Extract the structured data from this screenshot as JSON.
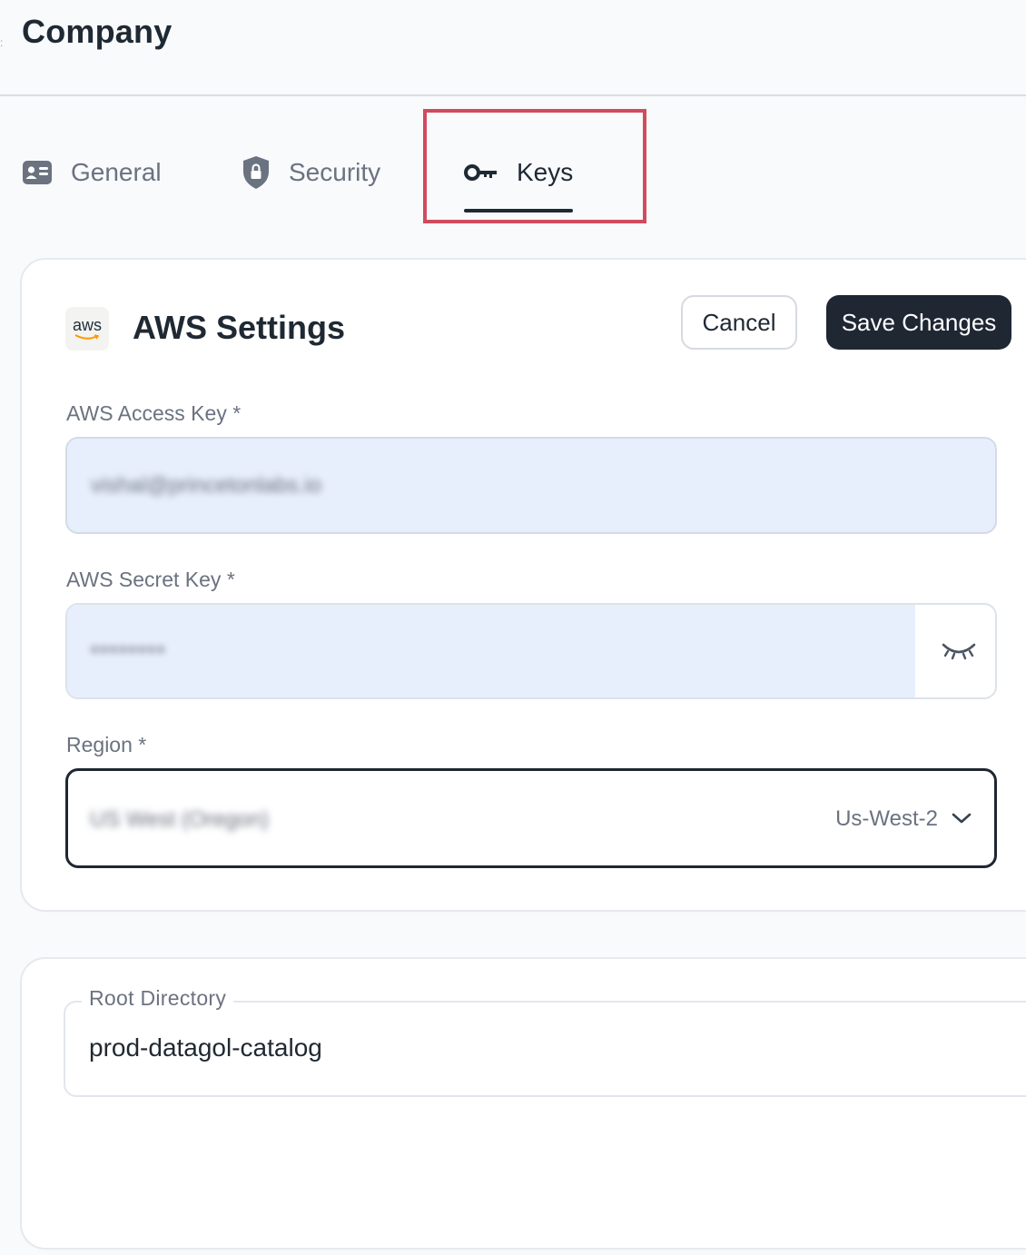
{
  "header": {
    "title": "Company"
  },
  "tabs": [
    {
      "label": "General",
      "icon": "id-card-icon",
      "active": false
    },
    {
      "label": "Security",
      "icon": "shield-lock-icon",
      "active": false
    },
    {
      "label": "Keys",
      "icon": "key-icon",
      "active": true
    }
  ],
  "aws_settings": {
    "logo_text": "aws",
    "title": "AWS Settings",
    "cancel_label": "Cancel",
    "save_label": "Save Changes",
    "access_key": {
      "label": "AWS Access Key *",
      "value": "vishal@princetonlabs.io"
    },
    "secret_key": {
      "label": "AWS Secret Key *",
      "value": "••••••••",
      "toggle_icon": "eye-closed-icon"
    },
    "region": {
      "label": "Region *",
      "value": "US West (Oregon)",
      "code": "Us-West-2"
    }
  },
  "root_directory": {
    "label": "Root Directory",
    "value": "prod-datagol-catalog"
  },
  "colors": {
    "highlight": "#d14b5e",
    "primary_button": "#1f2733",
    "input_fill": "#e8effc"
  }
}
